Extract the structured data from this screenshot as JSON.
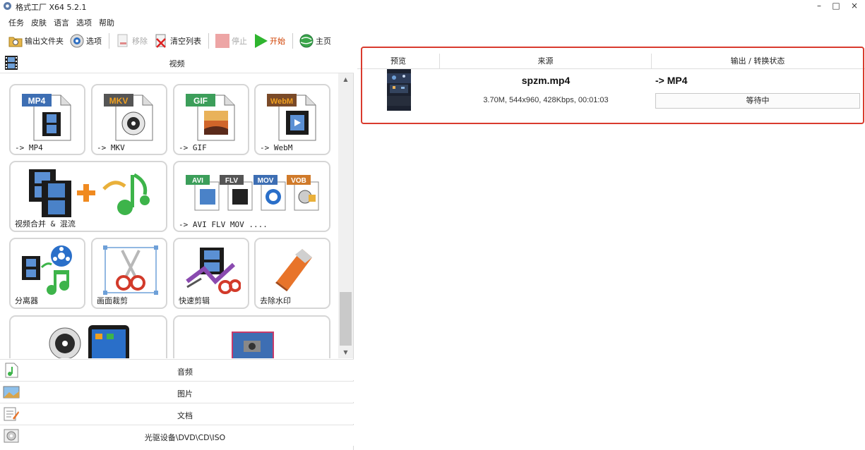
{
  "window": {
    "title": "格式工厂 X64 5.2.1",
    "minimize": "–",
    "maximize": "□",
    "close": "×"
  },
  "menu": [
    "任务",
    "皮肤",
    "语言",
    "选项",
    "帮助"
  ],
  "toolbar": {
    "output_folder": "输出文件夹",
    "options": "选项",
    "remove": "移除",
    "clear_list": "清空列表",
    "stop": "停止",
    "start": "开始",
    "home": "主页"
  },
  "categories": {
    "video": "视频",
    "audio": "音频",
    "image": "图片",
    "document": "文档",
    "disc": "光驱设备\\DVD\\CD\\ISO"
  },
  "tiles": {
    "mp4": {
      "badge": "MP4",
      "label": "-> MP4"
    },
    "mkv": {
      "badge": "MKV",
      "label": "-> MKV"
    },
    "gif": {
      "badge": "GIF",
      "label": "-> GIF"
    },
    "webm": {
      "badge": "WebM",
      "label": "-> WebM"
    },
    "merge": {
      "label": "视频合并 & 混流"
    },
    "multi": {
      "badges": [
        "AVI",
        "FLV",
        "MOV",
        "VOB"
      ],
      "label": "-> AVI FLV MOV ...."
    },
    "splitter": {
      "label": "分离器"
    },
    "crop": {
      "label": "画面裁剪"
    },
    "quick_clip": {
      "label": "快速剪辑"
    },
    "watermark": {
      "label": "去除水印"
    }
  },
  "table": {
    "headers": {
      "preview": "预览",
      "source": "来源",
      "output": "输出 / 转换状态"
    },
    "rows": [
      {
        "filename": "spzm.mp4",
        "info": "3.70M, 544x960, 428Kbps, 00:01:03",
        "target": "-> MP4",
        "status": "等待中"
      }
    ]
  },
  "colors": {
    "highlight": "#d93b2e",
    "start": "#d04000"
  }
}
